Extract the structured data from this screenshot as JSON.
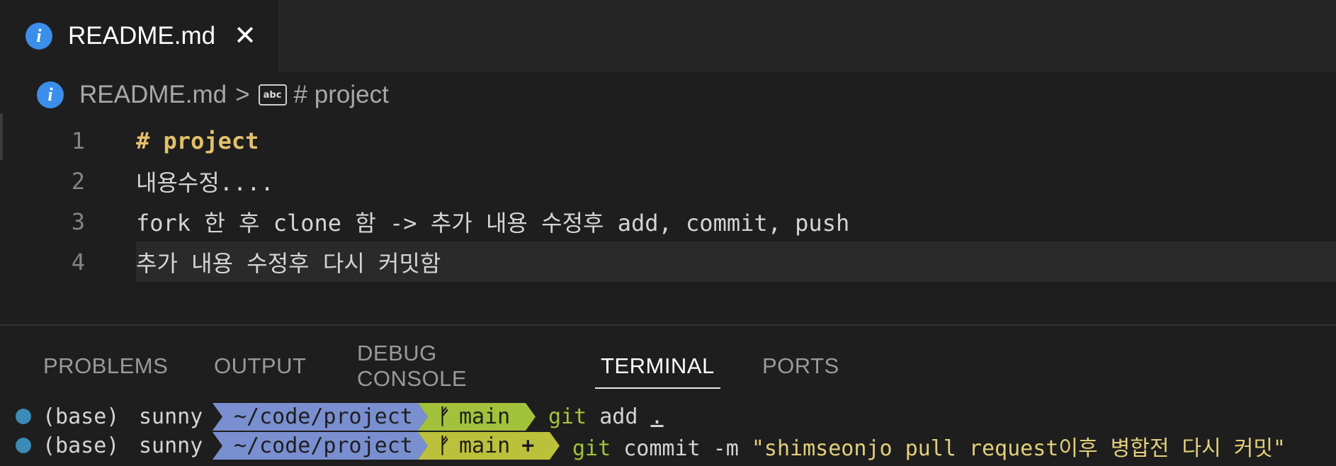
{
  "tab": {
    "label": "README.md",
    "close_glyph": "✕"
  },
  "breadcrumb": {
    "file": "README.md",
    "separator": ">",
    "symbol": "# project"
  },
  "editor": {
    "lines": [
      {
        "num": "1",
        "text": "# project"
      },
      {
        "num": "2",
        "text": "내용수정...."
      },
      {
        "num": "3",
        "text": "fork 한 후 clone 함 -> 추가 내용 수정후 add, commit, push"
      },
      {
        "num": "4",
        "text": "추가 내용 수정후 다시 커밋함"
      }
    ]
  },
  "panel": {
    "tabs": [
      "PROBLEMS",
      "OUTPUT",
      "DEBUG CONSOLE",
      "TERMINAL",
      "PORTS"
    ],
    "active_tab": "TERMINAL"
  },
  "terminal": {
    "lines": [
      {
        "env": "(base)",
        "user": "sunny",
        "path": "~/code/project",
        "branch": "main",
        "dirty": "",
        "git": "git",
        "cmd": " add ",
        "arg": "."
      },
      {
        "env": "(base)",
        "user": "sunny",
        "path": "~/code/project",
        "branch": "main",
        "dirty": "+",
        "git": "git",
        "cmd": " commit -m ",
        "arg": "\"shimseonjo pull request이후 병합전 다시 커밋\""
      }
    ]
  },
  "colors": {
    "info_icon": "#3b8eea",
    "heading": "#e2c06b",
    "path_segment": "#7a8fd0",
    "branch_segment": "#a3c23b",
    "terminal_dot": "#3b8ab8"
  }
}
